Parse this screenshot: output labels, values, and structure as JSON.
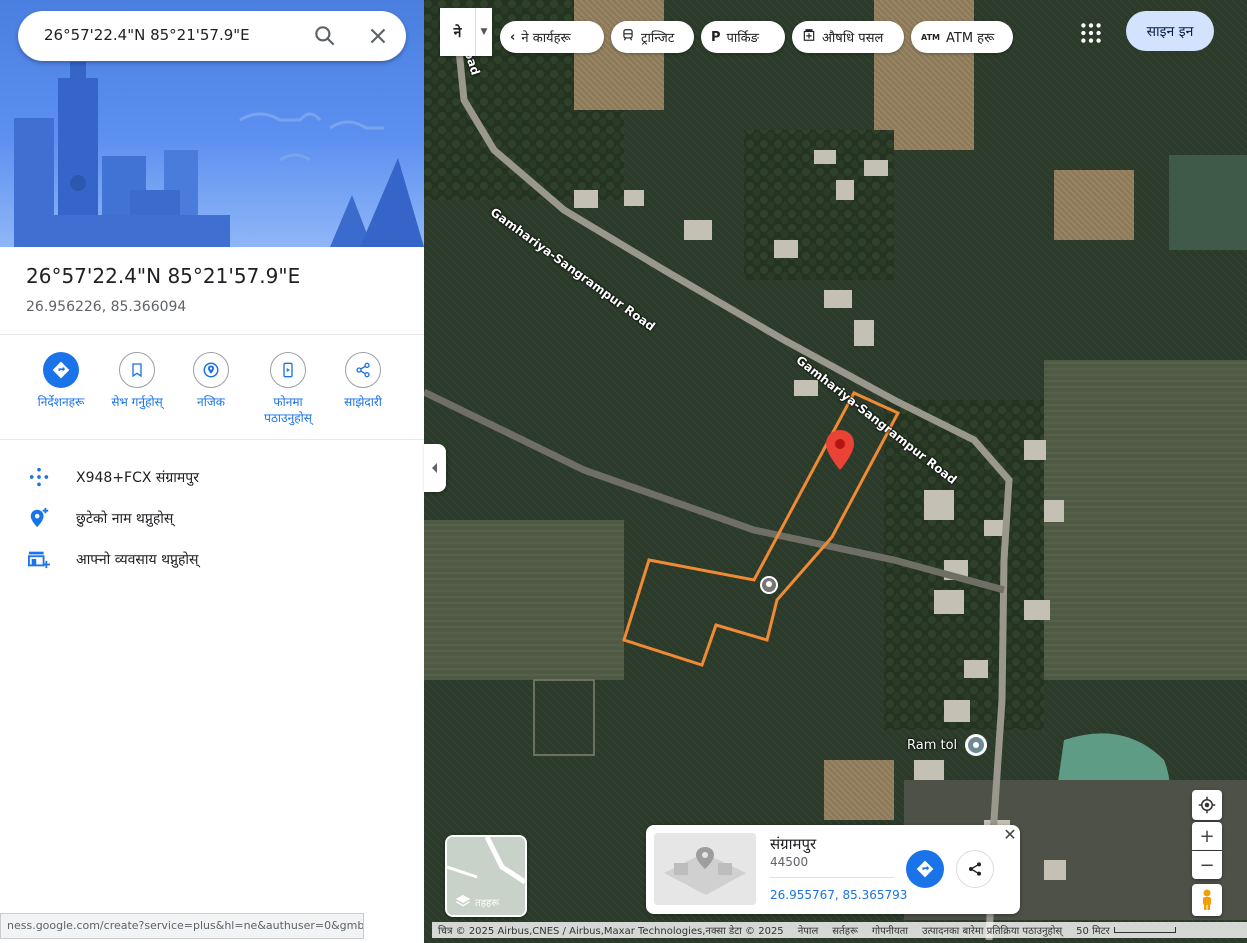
{
  "search": {
    "value": "26°57'22.4\"N 85°21'57.9\"E"
  },
  "place": {
    "title": "26°57'22.4\"N 85°21'57.9\"E",
    "decimal": "26.956226, 85.366094"
  },
  "actions": [
    {
      "label": "निर्देशनहरू",
      "icon": "directions-icon"
    },
    {
      "label": "सेभ गर्नुहोस्",
      "icon": "bookmark-icon"
    },
    {
      "label": "नजिक",
      "icon": "nearby-icon"
    },
    {
      "label": "फोनमा पठाउनुहोस्",
      "icon": "send-to-phone-icon"
    },
    {
      "label": "साझेदारी",
      "icon": "share-icon"
    }
  ],
  "details": [
    {
      "text": "X948+FCX संग्रामपुर",
      "icon": "plus-code-icon"
    },
    {
      "text": "छुटेको नाम थप्नुहोस्",
      "icon": "add-place-icon"
    },
    {
      "text": "आफ्नो व्यवसाय थप्नुहोस्",
      "icon": "add-business-icon"
    }
  ],
  "statusbar": "ness.google.com/create?service=plus&hl=ne&authuser=0&gmb...",
  "map": {
    "lang_label": "ने",
    "chips": [
      {
        "label": "ने कार्यहरू",
        "icon": "chevron-left-icon"
      },
      {
        "label": "ट्रान्जिट",
        "icon": "transit-icon"
      },
      {
        "label": "पार्किङ",
        "icon": "parking-icon"
      },
      {
        "label": "औषधि पसल",
        "icon": "pharmacy-icon"
      },
      {
        "label": "ATM हरू",
        "icon": "atm-icon"
      }
    ],
    "signin": "साइन इन",
    "road_labels": [
      "Gamhariya-Sangrampur Road",
      "Gamhariya-Sangrampur Road",
      "Road"
    ],
    "place_label": "Ram tol",
    "layers_label": "तहहरू",
    "card": {
      "name": "संग्रामपुर",
      "postcode": "44500",
      "coords": "26.955767, 85.365793"
    },
    "attribution": {
      "imagery": "चित्र © 2025 Airbus,CNES / Airbus,Maxar Technologies,नक्सा डेटा © 2025",
      "nepal": "नेपाल",
      "terms": "सर्तहरू",
      "privacy": "गोपनीयता",
      "feedback": "उत्पादनका बारेमा प्रतिक्रिया पठाउनुहोस्",
      "scale": "50 मिटर"
    },
    "colors": {
      "boundary": "#f08a35",
      "pin": "#ea4335",
      "accent": "#1a73e8"
    }
  }
}
